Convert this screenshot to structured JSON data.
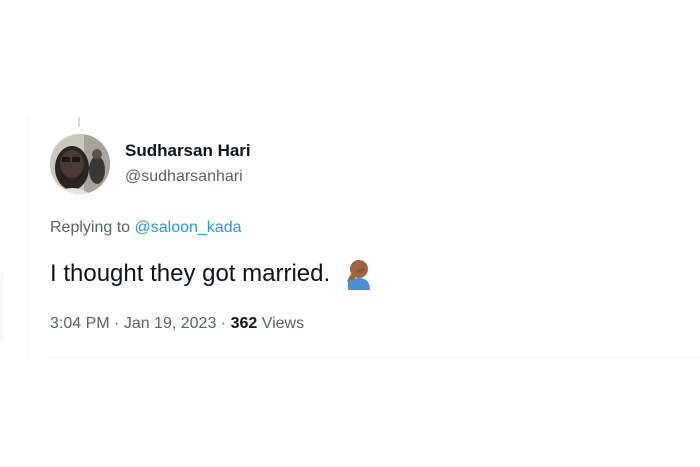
{
  "tweet": {
    "author": {
      "display_name": "Sudharsan Hari",
      "handle": "@sudharsanhari"
    },
    "replying_to": {
      "prefix": "Replying to",
      "mention": "@saloon_kada"
    },
    "text": "I thought they got married.",
    "emoji": "face-palm-icon",
    "time": "3:04 PM",
    "date": "Jan 19, 2023",
    "separator_1": " · ",
    "separator_2": " · ",
    "views_count": "362",
    "views_label": "Views"
  },
  "colors": {
    "text_primary": "#0f1419",
    "text_secondary": "#536471",
    "link": "#1d9bf0",
    "divider": "#eff3f4"
  }
}
